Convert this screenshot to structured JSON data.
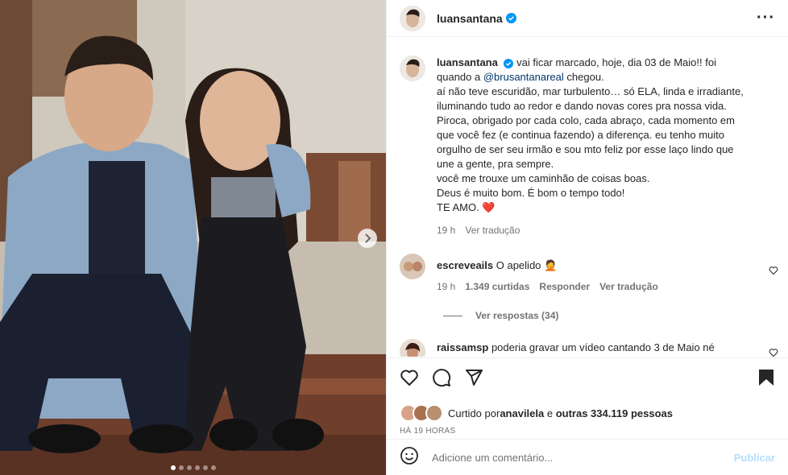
{
  "post": {
    "username": "luansantana",
    "more_icon": "more-horizontal-icon",
    "caption": {
      "mention": "@brusantanareal",
      "line1_pre": "vai ficar marcado, hoje, dia 03 de Maio!! foi",
      "line2_pre": "quando a ",
      "line2_post": " chegou.",
      "line3": "aí não teve escuridão, mar turbulento… só ELA, linda e irradiante,",
      "line4": "iluminando tudo ao redor e dando novas cores pra nossa vida.",
      "line5": "Piroca, obrigado por cada colo, cada abraço, cada momento em",
      "line6": "que você fez (e continua fazendo) a diferença. eu tenho muito",
      "line7": "orgulho de ser seu irmão e sou mto feliz por esse laço lindo que",
      "line8": "une a gente, pra sempre.",
      "line9": "você me trouxe um caminhão de coisas boas.",
      "line10": "Deus é muito bom. É bom o tempo todo!",
      "line11": "TE AMO. ",
      "emoji": "❤️",
      "time": "19 h",
      "translate": "Ver tradução"
    }
  },
  "comments": [
    {
      "username": "escreveails",
      "text": "O apelido 🤦",
      "time": "19 h",
      "likes": "1.349 curtidas",
      "reply": "Responder",
      "translate": "Ver tradução",
      "view_replies": "Ver respostas (34)"
    },
    {
      "username": "raissamsp",
      "text": "poderia gravar um vídeo cantando 3 de Maio né"
    }
  ],
  "likes": {
    "prefix": "Curtido por ",
    "user": "anavilela",
    "middle": " e ",
    "others": "outras 334.119 pessoas"
  },
  "time_ago": "HÁ 19 HORAS",
  "add_comment": {
    "placeholder": "Adicione um comentário...",
    "publish": "Publicar"
  },
  "colors": {
    "verified": "#0095f6",
    "heart": "#ed4956",
    "link": "#00376b",
    "publish_disabled": "#b2dffc"
  },
  "carousel": {
    "slides": 6,
    "current": 1
  }
}
